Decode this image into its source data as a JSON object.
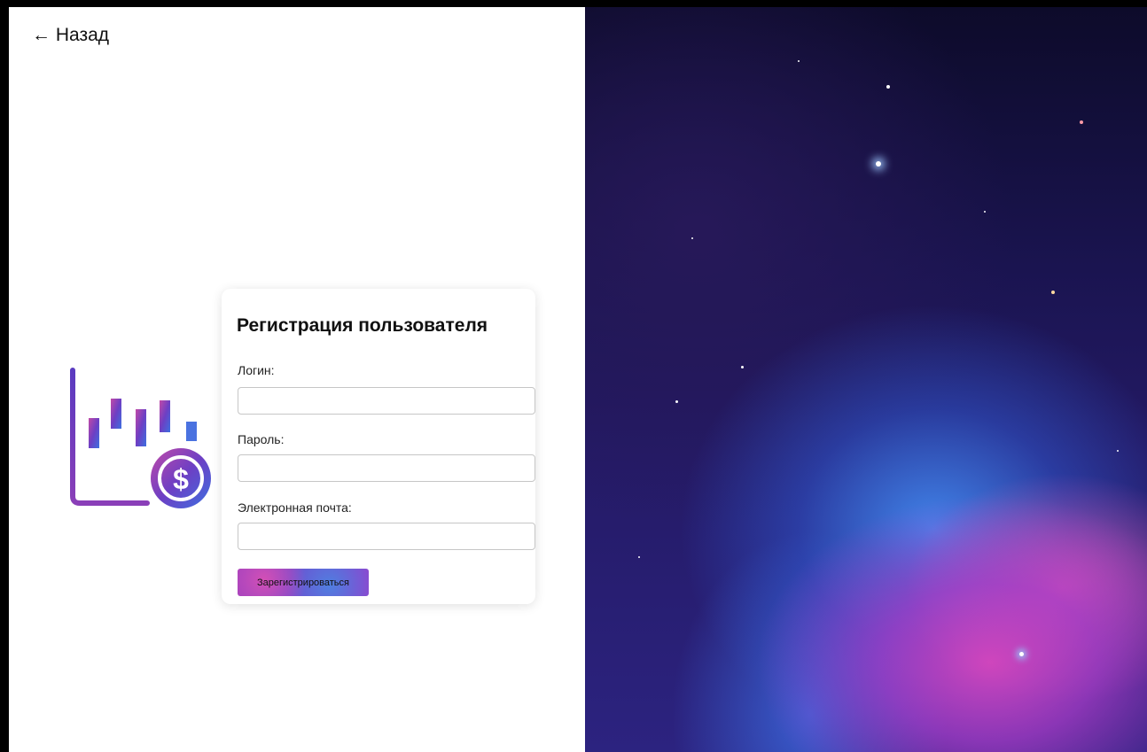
{
  "nav": {
    "back_label": "← Назад"
  },
  "form": {
    "title": "Регистрация пользователя",
    "fields": [
      {
        "label": "Логин:",
        "value": "",
        "placeholder": ""
      },
      {
        "label": "Пароль:",
        "value": "",
        "placeholder": ""
      },
      {
        "label": "Электронная почта:",
        "value": "",
        "placeholder": ""
      }
    ],
    "submit_label": "Зарегистрироваться"
  },
  "logo": {
    "icon": "candlestick-chart-dollar-icon"
  },
  "background": {
    "image": "space-nebula"
  },
  "colors": {
    "accent_pink": "#d44fb6",
    "accent_blue": "#4f7fe0",
    "accent_purple": "#7a3fc8"
  }
}
